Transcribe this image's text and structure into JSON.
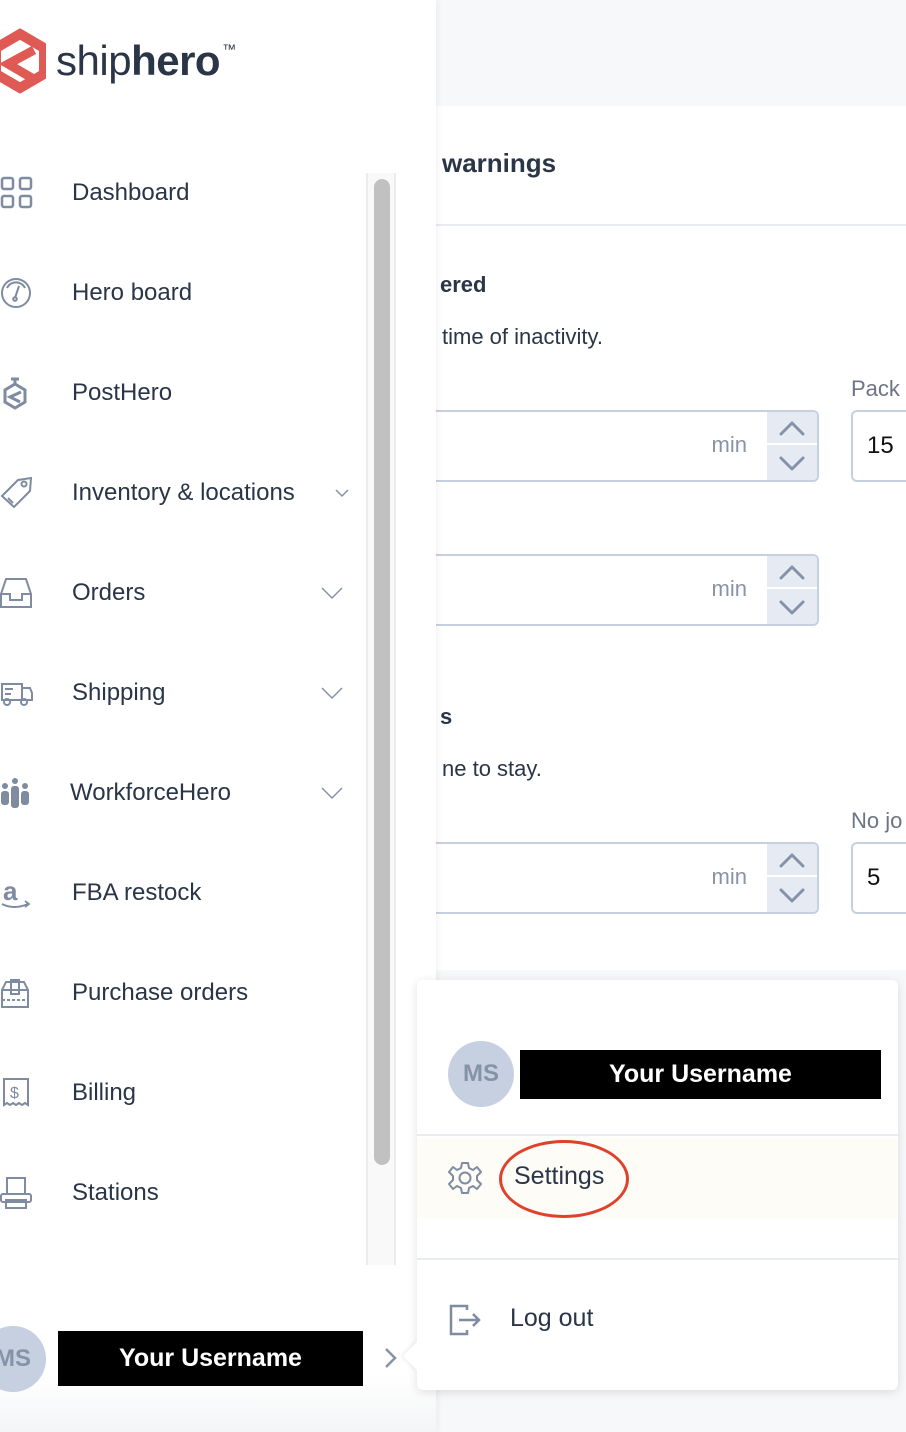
{
  "brand": {
    "name_light": "ship",
    "name_bold": "hero",
    "trademark": "™",
    "accent_color": "#e05a55"
  },
  "sidebar": {
    "items": [
      {
        "label": "Dashboard",
        "icon": "grid-icon",
        "has_chevron": false
      },
      {
        "label": "Hero board",
        "icon": "gauge-icon",
        "has_chevron": false
      },
      {
        "label": "PostHero",
        "icon": "posthero-icon",
        "has_chevron": false
      },
      {
        "label": "Inventory & locations",
        "icon": "tag-icon",
        "has_chevron": true
      },
      {
        "label": "Orders",
        "icon": "inbox-icon",
        "has_chevron": true
      },
      {
        "label": "Shipping",
        "icon": "truck-icon",
        "has_chevron": true
      },
      {
        "label": "WorkforceHero",
        "icon": "team-icon",
        "has_chevron": true
      },
      {
        "label": "FBA restock",
        "icon": "amazon-icon",
        "has_chevron": false
      },
      {
        "label": "Purchase orders",
        "icon": "package-icon",
        "has_chevron": false
      },
      {
        "label": "Billing",
        "icon": "receipt-icon",
        "has_chevron": false
      },
      {
        "label": "Stations",
        "icon": "printer-icon",
        "has_chevron": false
      }
    ],
    "user": {
      "initials": "MS",
      "name": "Your Username"
    }
  },
  "main": {
    "card_title": "warnings",
    "section1": {
      "title": "ered",
      "description": "time of inactivity."
    },
    "section2": {
      "title": "s",
      "description": "ne to stay."
    },
    "fields": {
      "stepper1_unit": "min",
      "stepper2_unit": "min",
      "stepper3_unit": "min",
      "pack_label": "Pack",
      "pack_value": "15",
      "nojob_label": "No jo",
      "nojob_value": "5"
    }
  },
  "popover": {
    "initials": "MS",
    "name": "Your Username",
    "settings_label": "Settings",
    "logout_label": "Log out"
  }
}
